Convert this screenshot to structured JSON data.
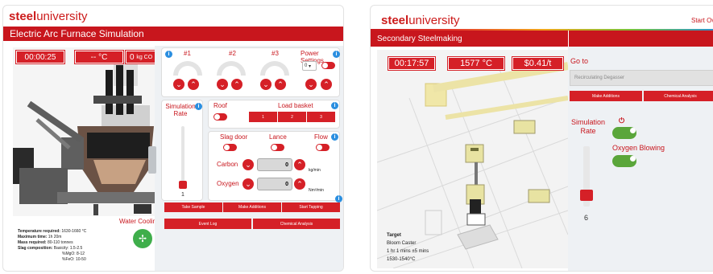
{
  "left": {
    "brand_bold": "steel",
    "brand_thin": "university",
    "title": "Electric Arc Furnace Simulation",
    "timer": "00:00:25",
    "temp": "-- °C",
    "mass_prefix": "0",
    "mass_unit": "kg CO",
    "electrodes": [
      "#1",
      "#2",
      "#3"
    ],
    "power_settings": "Power Settings",
    "power_value": "0",
    "sim_rate_label": "Simulation Rate",
    "sim_rate_value": "1",
    "roof": "Roof",
    "load_basket": "Load basket",
    "baskets": [
      "1",
      "2",
      "3"
    ],
    "slag_door": "Slag door",
    "lance": "Lance",
    "flow": "Flow",
    "carbon": "Carbon",
    "carbon_value": "0",
    "carbon_unit": "kg/min",
    "oxygen": "Oxygen",
    "oxygen_value": "0",
    "oxygen_unit": "Nm³/min",
    "take_sample": "Take Sample",
    "make_additions": "Make Additions",
    "start_tapping": "Start Tapping",
    "event_log": "Event Log",
    "chemical_analysis": "Chemical Analysis",
    "water_cooling": "Water Cooling",
    "targets": [
      {
        "label": "Temperature required:",
        "value": "1630-1660 °C"
      },
      {
        "label": "Maximum time:",
        "value": "1h 20m"
      },
      {
        "label": "Mass required:",
        "value": "80-110 tonnes"
      },
      {
        "label": "Slag composition:",
        "value": "Basicity: 1.5-2.5"
      }
    ],
    "slag_extra": [
      "%MgO: 8-12",
      "%FeO: 10-50"
    ]
  },
  "right": {
    "brand_bold": "steel",
    "brand_thin": "university",
    "start_link": "Start Ov",
    "title": "Secondary Steelmaking",
    "timer": "00:17:57",
    "temp": "1577 °C",
    "cost": "$0.41/t",
    "goto_label": "Go to",
    "goto_value": "Recirculating Degasser",
    "make_additions": "Make Additions",
    "chemical_analysis": "Chemical Analysis",
    "sim_rate_label": "Simulation Rate",
    "oxygen_blowing": "Oxygen Blowing",
    "sim_rate_value": "6",
    "target_title": "Target",
    "target_lines": [
      "Bloom Caster",
      "1 hr 1 mins ±5 mins",
      "1530-1540°C"
    ]
  },
  "colors": {
    "accent": "#c8161d",
    "toggle_on": "#5aa63a",
    "info": "#2b8fe0"
  }
}
